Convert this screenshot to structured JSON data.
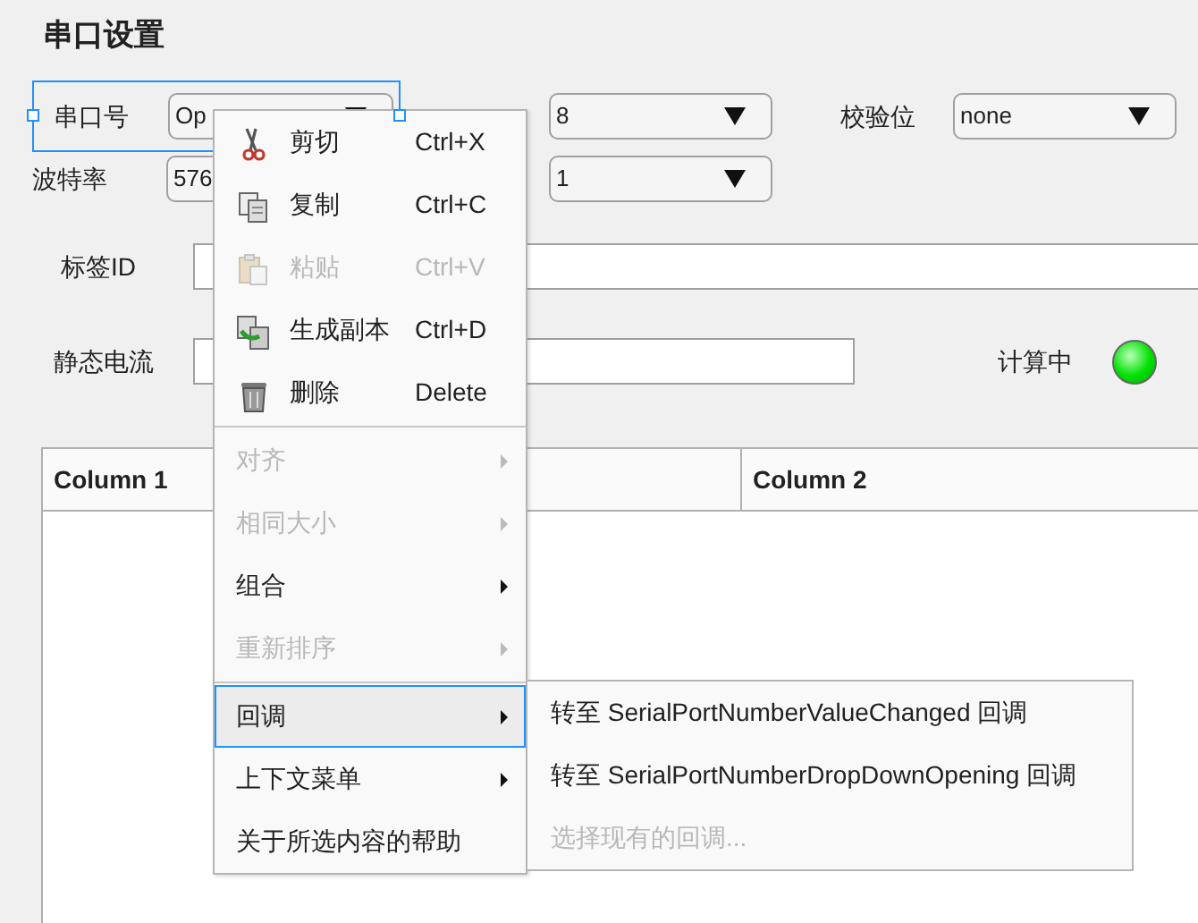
{
  "title": "串口设置",
  "form_rows": [
    {
      "fields": [
        {
          "kind": "dropdown",
          "label": "串口号",
          "value": "Op",
          "selected": true
        },
        {
          "kind": "dropdown",
          "value": "8",
          "selected": false
        },
        {
          "kind": "dropdown",
          "label": "校验位",
          "value": "none",
          "selected": false
        }
      ]
    },
    {
      "fields": [
        {
          "kind": "dropdown",
          "label": "波特率",
          "value": "576",
          "selected": false
        },
        {
          "kind": "dropdown",
          "value": "1",
          "selected": false
        }
      ]
    },
    {
      "fields": [
        {
          "kind": "text",
          "label": "标签ID",
          "selected": false
        }
      ]
    },
    {
      "fields": [
        {
          "kind": "text",
          "label": "静态电流",
          "selected": false
        },
        {
          "kind": "lamp",
          "label": "计算中",
          "on": true
        }
      ]
    }
  ],
  "table": {
    "columns": [
      "Column 1",
      "Column 2"
    ]
  },
  "context_menu": {
    "items": [
      {
        "kind": "item",
        "label": "剪切",
        "shortcut": "Ctrl+X",
        "disabled": false,
        "selected": false
      },
      {
        "kind": "item",
        "label": "复制",
        "shortcut": "Ctrl+C",
        "disabled": false,
        "selected": false
      },
      {
        "kind": "item",
        "label": "粘贴",
        "shortcut": "Ctrl+V",
        "disabled": true,
        "selected": false
      },
      {
        "kind": "item",
        "label": "生成副本",
        "shortcut": "Ctrl+D",
        "disabled": false,
        "selected": false
      },
      {
        "kind": "item",
        "label": "删除",
        "shortcut": "Delete",
        "disabled": false,
        "selected": false
      },
      {
        "kind": "separator"
      },
      {
        "kind": "item",
        "label": "对齐",
        "submenu": true,
        "disabled": true,
        "selected": false
      },
      {
        "kind": "item",
        "label": "相同大小",
        "submenu": true,
        "disabled": true,
        "selected": false
      },
      {
        "kind": "item",
        "label": "组合",
        "submenu": true,
        "disabled": false,
        "selected": false
      },
      {
        "kind": "item",
        "label": "重新排序",
        "submenu": true,
        "disabled": true,
        "selected": false
      },
      {
        "kind": "separator"
      },
      {
        "kind": "item",
        "label": "回调",
        "submenu": true,
        "disabled": false,
        "selected": true
      },
      {
        "kind": "item",
        "label": "上下文菜单",
        "submenu": true,
        "disabled": false,
        "selected": false
      },
      {
        "kind": "item",
        "label": "关于所选内容的帮助",
        "disabled": false,
        "selected": false
      }
    ]
  },
  "submenu": {
    "items": [
      {
        "label": "转至 SerialPortNumberValueChanged 回调",
        "disabled": false
      },
      {
        "label": "转至 SerialPortNumberDropDownOpening 回调",
        "disabled": false
      },
      {
        "label": "选择现有的回调...",
        "disabled": true
      }
    ]
  }
}
